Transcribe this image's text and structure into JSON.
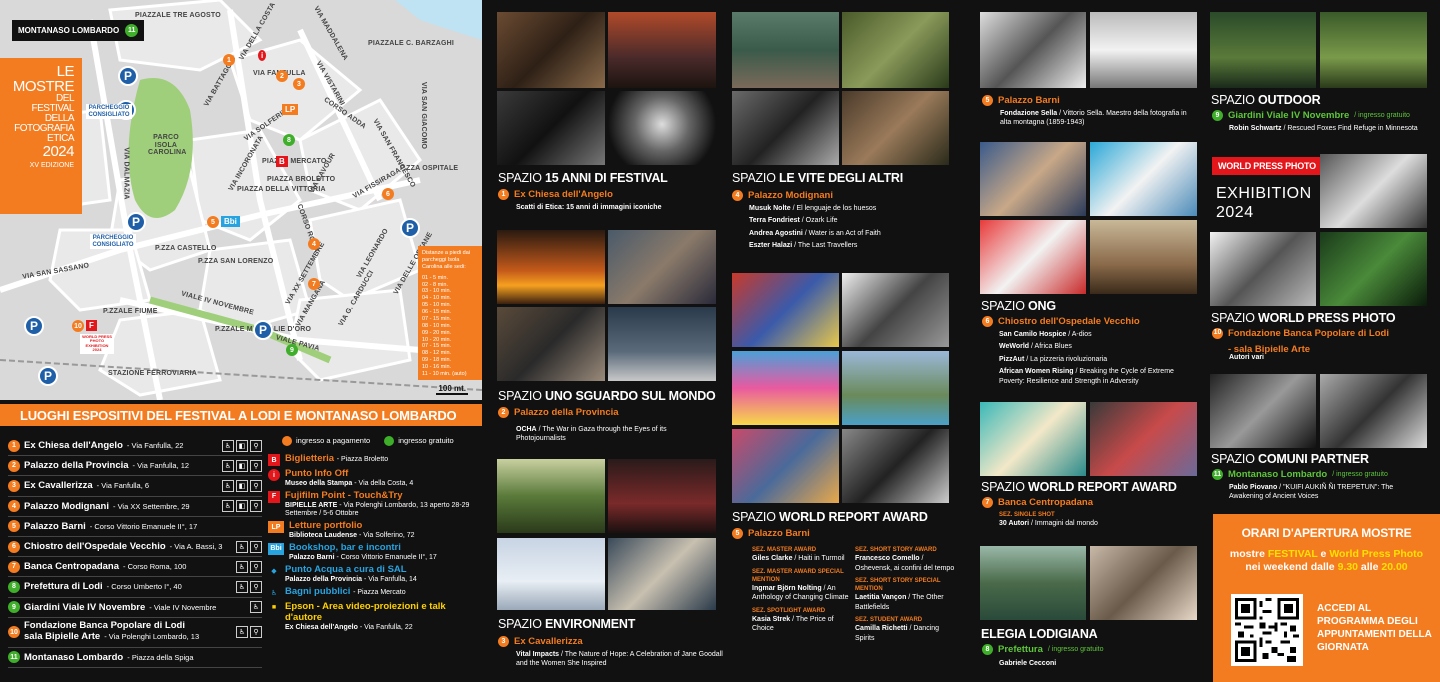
{
  "map": {
    "chip": {
      "label": "MONTANASO LOMBARDO",
      "num": "11"
    },
    "title_lines": [
      "LE",
      "MOSTRE",
      "DEL",
      "FESTIVAL",
      "DELLA",
      "FOTOGRAFIA",
      "ETICA",
      "2024"
    ],
    "edition": "XV EDIZIONE",
    "parking_labels": [
      "PARCHEGGIO CONSIGLIATO",
      "PARCHEGGIO CONSIGLIATO"
    ],
    "park_letter": "P",
    "parco": "PARCO ISOLA CAROLINA",
    "streets": [
      "PIAZZALE TRE AGOSTO",
      "PIAZZALE C. BARZAGHI",
      "VIA MADDALENA",
      "VIA VISTARINI",
      "VIA DELLA COSTA",
      "VIA BATTAGGIO",
      "VIA FANFULLA",
      "VIA SOLFERINO",
      "CORSO ADDA",
      "VIA SAN GIACOMO",
      "VIA SAN FRANCESCO",
      "VIA INCORONATA",
      "VIA CAVOUR",
      "PIAZZA MERCATO",
      "PIAZZA BROLETTO",
      "PIAZZA DELLA VITTORIA",
      "CORSO ROMA",
      "VIA FISSIRAGA",
      "P.ZZA OSPITALE",
      "VIA DALMAZIA",
      "VIA SAN SASSANO",
      "P.ZZA CASTELLO",
      "P.ZZA SAN LORENZO",
      "VIA XX SETTEMBRE",
      "VIA LEONARDO",
      "VIA DELLE ORFANE",
      "VIA MANGANA",
      "VIA G. CARDUCCI",
      "VIALE IV NOVEMBRE",
      "P.ZZALE MEDAGLIE D'ORO",
      "VIALE PAVIA",
      "P.ZZALE FIUME",
      "STAZIONE FERROVIARIA",
      "VIA DEFENDENTE LODI",
      "VIA NINO DALL'ORO",
      "VIA ZANELLI",
      "VIALE AGNELLI",
      "P.ZZA ZANELLI",
      "CORSO UMBERTO I"
    ],
    "distances_header": "Distanze a piedi dai parcheggi Isola Carolina alle sedi:",
    "distances": [
      "01 - 5 min.",
      "02 - 8 min.",
      "03 - 10 min.",
      "04 - 10 min.",
      "05 - 10 min.",
      "06 - 15 min.",
      "07 - 15 min.",
      "08 - 10 min.",
      "09 - 20 min.",
      "10 - 20 min.",
      "07 - 15 min.",
      "08 - 12 min.",
      "09 - 18 min.",
      "10 - 16 min.",
      "11 - 10 min. (auto)"
    ],
    "scale": "100 mt.",
    "badge_lp": "LP",
    "badge_bbi": "Bbi",
    "badge_b": "B",
    "badge_f": "F",
    "badge_i": "i",
    "wpp_mini": "WORLD PRESS PHOTO EXHIBITION 2024"
  },
  "legend": {
    "bar_title": "LUOGHI ESPOSITIVI DEL FESTIVAL A LODI E MONTANASO LOMBARDO",
    "paid": "ingresso a pagamento",
    "free": "ingresso gratuito",
    "venues": [
      {
        "num": "1",
        "name": "Ex Chiesa dell'Angelo",
        "addr": "- Via Fanfulla, 22",
        "color": "o"
      },
      {
        "num": "2",
        "name": "Palazzo della Provincia",
        "addr": "- Via Fanfulla, 12",
        "color": "o"
      },
      {
        "num": "3",
        "name": "Ex Cavallerizza",
        "addr": "- Via Fanfulla, 6",
        "color": "o"
      },
      {
        "num": "4",
        "name": "Palazzo Modignani",
        "addr": "- Via XX Settembre, 29",
        "color": "o"
      },
      {
        "num": "5",
        "name": "Palazzo Barni",
        "addr": "- Corso Vittorio Emanuele II°, 17",
        "color": "o"
      },
      {
        "num": "6",
        "name": "Chiostro dell'Ospedale Vecchio",
        "addr": "- Via A. Bassi, 3",
        "color": "o"
      },
      {
        "num": "7",
        "name": "Banca Centropadana",
        "addr": "- Corso Roma, 100",
        "color": "o"
      },
      {
        "num": "8",
        "name": "Prefettura di Lodi",
        "addr": "- Corso Umberto I°, 40",
        "color": "g"
      },
      {
        "num": "9",
        "name": "Giardini Viale IV Novembre",
        "addr": "- Viale IV Novembre",
        "color": "g"
      },
      {
        "num": "10",
        "name": "Fondazione Banca Popolare di Lodi",
        "name2": "sala Bipielle Arte",
        "addr": "- Via Polenghi Lombardo, 13",
        "color": "o"
      },
      {
        "num": "11",
        "name": "Montanaso Lombardo",
        "addr": "- Piazza della Spiga",
        "color": "g"
      }
    ],
    "services": [
      {
        "icon": "B",
        "name": "Biglietteria",
        "sub": "- Piazza Broletto",
        "subb": "",
        "cls": ""
      },
      {
        "icon": "i",
        "name": "Punto Info Off",
        "subb": "Museo della Stampa",
        "sub": "- Via della Costa, 4",
        "cls": ""
      },
      {
        "icon": "F",
        "name": "Fujifilm Point - Touch&Try",
        "subb": "BIPIELLE ARTE",
        "sub": "- Via Polenghi Lombardo, 13 aperto 28-29 Settembre / 5-6 Ottobre",
        "cls": ""
      },
      {
        "icon": "LP",
        "name": "Letture portfolio",
        "subb": "Biblioteca Laudense",
        "sub": "- Via Solferino, 72",
        "cls": ""
      },
      {
        "icon": "Bbi",
        "name": "Bookshop, bar e incontri",
        "subb": "Palazzo Barni",
        "sub": "- Corso Vittorio Emanuele II°, 17",
        "cls": "blue"
      },
      {
        "icon": "◆",
        "name": "Punto Acqua a cura di SAL",
        "subb": "Palazzo della Provincia",
        "sub": "- Via Fanfulla, 14",
        "cls": "blue"
      },
      {
        "icon": "♿",
        "name": "Bagni pubblici",
        "subb": "",
        "sub": "- Piazza Mercato",
        "cls": "blue"
      },
      {
        "icon": "■",
        "name": "Epson - Area video-proiezioni e talk d'autore",
        "subb": "Ex Chiesa dell'Angelo",
        "sub": "- Via Fanfulla, 22",
        "cls": "yel"
      }
    ]
  },
  "sections": {
    "s15": {
      "pre": "SPAZIO",
      "title": "15 ANNI DI FESTIVAL",
      "num": "1",
      "venue": "Ex Chiesa dell'Angelo",
      "credits": [
        {
          "b": "Scatti di Etica: 15 anni di immagini iconiche",
          "t": ""
        }
      ]
    },
    "sguardo": {
      "pre": "SPAZIO",
      "title": "UNO SGUARDO SUL MONDO",
      "num": "2",
      "venue": "Palazzo della Provincia",
      "credits": [
        {
          "b": "OCHA",
          "t": " / The War in Gaza through the Eyes of its Photojournalists"
        }
      ]
    },
    "env": {
      "pre": "SPAZIO",
      "title": "ENVIRONMENT",
      "num": "3",
      "venue": "Ex Cavallerizza",
      "credits": [
        {
          "b": "Vital Impacts",
          "t": " / The Nature of Hope: A Celebration of Jane Goodall and the Women She Inspired"
        }
      ]
    },
    "vite": {
      "pre": "SPAZIO",
      "title": "LE VITE DEGLI ALTRI",
      "num": "4",
      "venue": "Palazzo Modignani",
      "credits": [
        {
          "b": "Musuk Nolte",
          "t": " / El lenguaje de los huesos"
        },
        {
          "b": "Terra Fondriest",
          "t": " / Ozark Life"
        },
        {
          "b": "Andrea Agostini",
          "t": " / Water is an Act of Faith"
        },
        {
          "b": "Eszter Halazi",
          "t": " / The Last Travellers"
        }
      ]
    },
    "wra": {
      "pre": "SPAZIO",
      "title": "WORLD REPORT AWARD",
      "num": "5",
      "venue": "Palazzo Barni",
      "left": [
        {
          "sez": "SEZ. MASTER AWARD",
          "b": "Giles Clarke",
          "t": " / Haiti in Turmoil"
        },
        {
          "sez": "SEZ. MASTER AWARD SPECIAL MENTION",
          "b": "Ingmar Björn Nolting",
          "t": " / An Anthology of Changing Climate"
        },
        {
          "sez": "SEZ. SPOTLIGHT AWARD",
          "b": "Kasia Strek",
          "t": " / The Price of Choice"
        }
      ],
      "right": [
        {
          "sez": "SEZ. SHORT STORY AWARD",
          "b": "Francesco Comello",
          "t": " / Oshevensk, ai confini del tempo"
        },
        {
          "sez": "SEZ. SHORT STORY SPECIAL MENTION",
          "b": "Laetitia Vançon",
          "t": " / The Other Battlefields"
        },
        {
          "sez": "SEZ. STUDENT AWARD",
          "b": "Camilla Richetti",
          "t": " / Dancing Spirits"
        }
      ]
    },
    "barni": {
      "num": "5",
      "venue": "Palazzo Barni",
      "credits": [
        {
          "b": "Fondazione Sella",
          "t": " / Vittorio Sella. Maestro della fotografia in alta montagna (1859-1943)"
        }
      ]
    },
    "ong": {
      "pre": "SPAZIO",
      "title": "ONG",
      "num": "6",
      "venue": "Chiostro dell'Ospedale Vecchio",
      "credits": [
        {
          "b": "San Camilo Hospice",
          "t": " / A-dios"
        },
        {
          "b": "WeWorld",
          "t": " / Africa Blues"
        },
        {
          "b": "PizzAut",
          "t": " / La pizzeria rivoluzionaria"
        },
        {
          "b": "African Women Rising",
          "t": " / Breaking the Cycle of Extreme Poverty: Resilience and Strength in Adversity"
        }
      ]
    },
    "wra2": {
      "pre": "SPAZIO",
      "title": "WORLD REPORT AWARD",
      "num": "7",
      "venue": "Banca Centropadana",
      "sez": "SEZ. SINGLE SHOT",
      "credits": [
        {
          "b": "30 Autori",
          "t": " / Immagini dal mondo"
        }
      ]
    },
    "elegia": {
      "title": "ELEGIA LODIGIANA",
      "num": "8",
      "venue": "Prefettura",
      "free": "/ ingresso gratuito",
      "credits": [
        {
          "b": "Gabriele Cecconi",
          "t": ""
        }
      ]
    },
    "outdoor": {
      "pre": "SPAZIO",
      "title": "OUTDOOR",
      "num": "9",
      "venue": "Giardini Viale IV Novembre",
      "free": "/ ingresso gratuito",
      "credits": [
        {
          "b": "Robin Schwartz",
          "t": " / Rescued Foxes Find Refuge in Minnesota"
        }
      ]
    },
    "wpp": {
      "logo": "WORLD PRESS PHOTO",
      "exh1": "EXHIBITION",
      "exh2": "2024",
      "pre": "SPAZIO",
      "title": "WORLD PRESS PHOTO",
      "num": "10",
      "venue": "Fondazione Banca Popolare di Lodi",
      "venue2": "- sala Bipielle Arte",
      "credits": [
        {
          "b": "Autori vari",
          "t": ""
        }
      ]
    },
    "comuni": {
      "pre": "SPAZIO",
      "title": "COMUNI PARTNER",
      "num": "11",
      "venue": "Montanaso Lombardo",
      "free": "/ ingresso gratuito",
      "credits": [
        {
          "b": "Pablo Piovano",
          "t": " / \"KUIFI AUKIÑ ÑI TREPETUN\": The Awakening of Ancient Voices"
        }
      ]
    }
  },
  "hours": {
    "title": "ORARI D'APERTURA MOSTRE",
    "line1a": "mostre ",
    "line1b": "FESTIVAL",
    "line1c": " e ",
    "line1d": "World Press Photo",
    "line2a": "nei weekend dalle ",
    "line2b": "9.30",
    "line2c": " alle ",
    "line2d": "20.00",
    "cta": "ACCEDI AL PROGRAMMA DEGLI APPUNTAMENTI DELLA GIORNATA"
  },
  "colors": {
    "accent": "#f47c20",
    "free": "#3fae2a",
    "park": "#1f5fa8",
    "wpp": "#e3161b"
  }
}
